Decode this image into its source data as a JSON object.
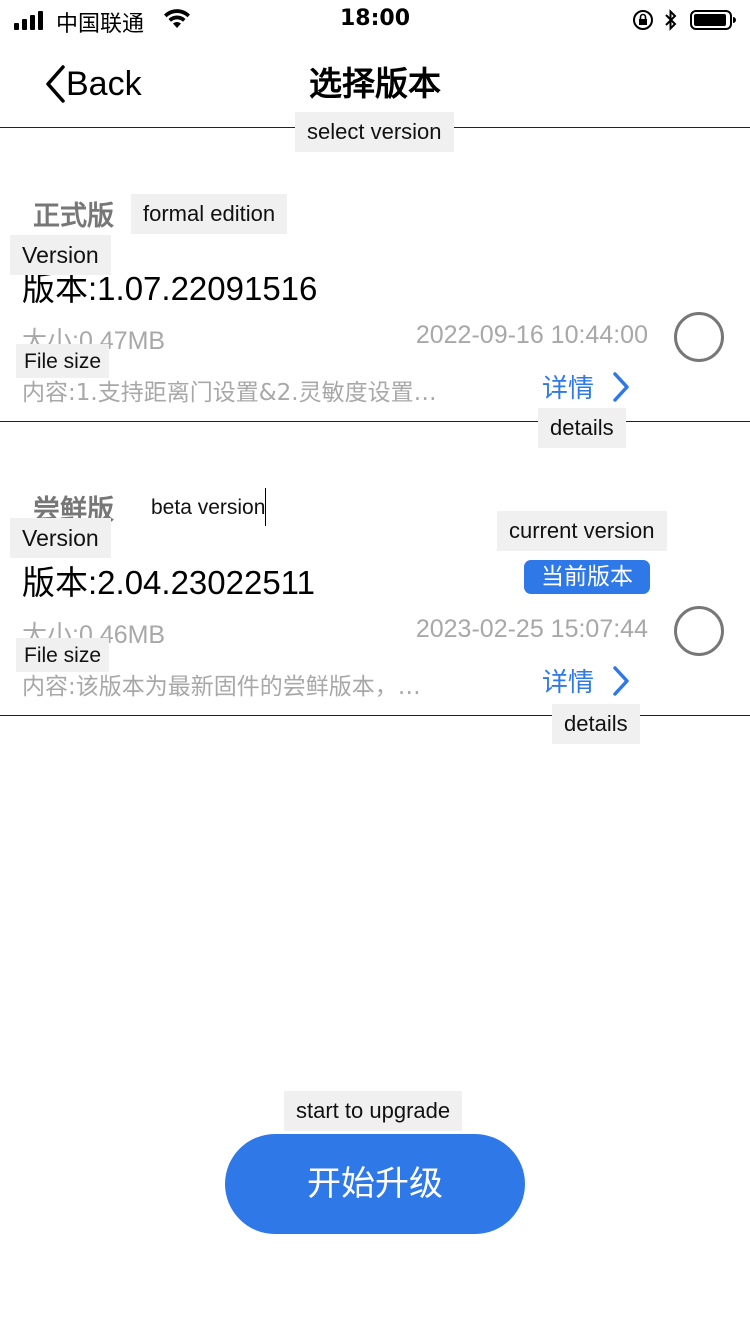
{
  "status_bar": {
    "carrier": "中国联通",
    "time": "18:00"
  },
  "nav": {
    "back_label": "Back",
    "title": "选择版本",
    "title_annotation": "select version"
  },
  "items": [
    {
      "edition": "正式版",
      "edition_annotation": "formal edition",
      "version": "版本:1.07.22091516",
      "version_annotation": "Version",
      "size": "大小:0.47MB",
      "size_annotation": "File size",
      "date": "2022-09-16 10:44:00",
      "content": "内容:1.支持距离门设置&2.灵敏度设置…",
      "details_label": "详情",
      "details_annotation": "details",
      "selected": false
    },
    {
      "edition": "尝鲜版",
      "edition_annotation": "beta version",
      "version": "版本:2.04.23022511",
      "version_annotation": "Version",
      "badge": "当前版本",
      "badge_annotation": "current version",
      "size": "大小:0.46MB",
      "size_annotation": "File size",
      "date": "2023-02-25 15:07:44",
      "content": "内容:该版本为最新固件的尝鲜版本，…",
      "details_label": "详情",
      "details_annotation": "details",
      "selected": false
    }
  ],
  "upgrade": {
    "label": "开始升级",
    "annotation": "start to upgrade"
  },
  "colors": {
    "accent": "#2f78e8",
    "muted_text": "#a8a8a8",
    "edition_text": "#777777",
    "annotation_bg": "#f0f0f0"
  }
}
